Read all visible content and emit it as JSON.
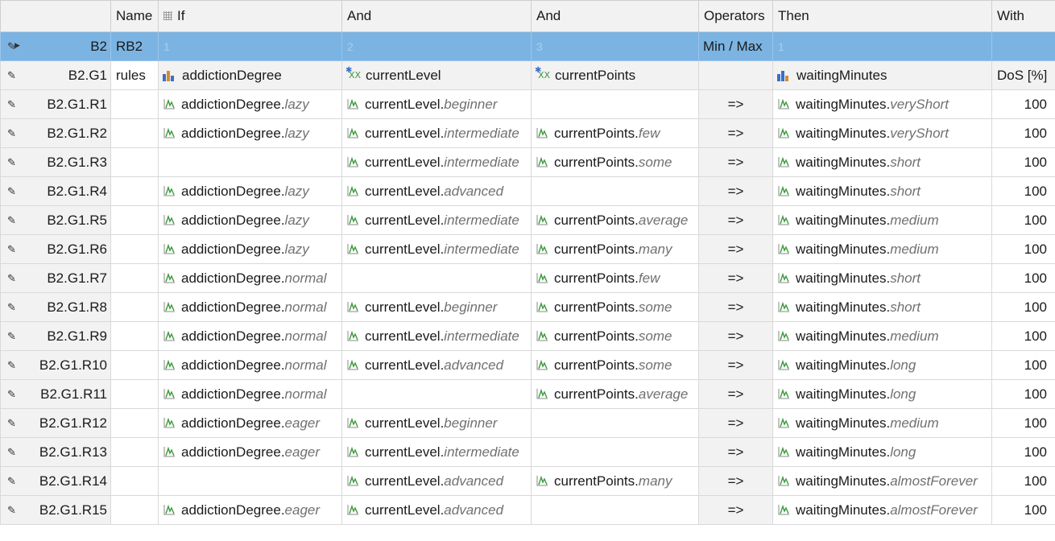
{
  "columns": {
    "rowhead": "",
    "name": "Name",
    "if": "If",
    "and1": "And",
    "and2": "And",
    "operators": "Operators",
    "then": "Then",
    "with": "With"
  },
  "rulebase": {
    "id": "B2",
    "name": "RB2",
    "if_num": "1",
    "and1_num": "2",
    "and2_num": "3",
    "operators": "Min / Max",
    "then_num": "1"
  },
  "group": {
    "id": "B2.G1",
    "name": "rules",
    "if_var": "addictionDegree",
    "and1_var": "currentLevel",
    "and2_var": "currentPoints",
    "then_var": "waitingMinutes",
    "with": "DoS [%]"
  },
  "colors": {
    "selected_row": "#7bb4e3",
    "header_bg": "#f2f2f2",
    "mf_icon": "#3b9a3b",
    "term_text": "#707070"
  },
  "rules": [
    {
      "id": "B2.G1.R1",
      "if_var": "addictionDegree",
      "if_term": "lazy",
      "and1_var": "currentLevel",
      "and1_term": "beginner",
      "and2_var": "",
      "and2_term": "",
      "op": "=>",
      "then_var": "waitingMinutes",
      "then_term": "veryShort",
      "dos": "100"
    },
    {
      "id": "B2.G1.R2",
      "if_var": "addictionDegree",
      "if_term": "lazy",
      "and1_var": "currentLevel",
      "and1_term": "intermediate",
      "and2_var": "currentPoints",
      "and2_term": "few",
      "op": "=>",
      "then_var": "waitingMinutes",
      "then_term": "veryShort",
      "dos": "100"
    },
    {
      "id": "B2.G1.R3",
      "if_var": "",
      "if_term": "",
      "and1_var": "currentLevel",
      "and1_term": "intermediate",
      "and2_var": "currentPoints",
      "and2_term": "some",
      "op": "=>",
      "then_var": "waitingMinutes",
      "then_term": "short",
      "dos": "100"
    },
    {
      "id": "B2.G1.R4",
      "if_var": "addictionDegree",
      "if_term": "lazy",
      "and1_var": "currentLevel",
      "and1_term": "advanced",
      "and2_var": "",
      "and2_term": "",
      "op": "=>",
      "then_var": "waitingMinutes",
      "then_term": "short",
      "dos": "100"
    },
    {
      "id": "B2.G1.R5",
      "if_var": "addictionDegree",
      "if_term": "lazy",
      "and1_var": "currentLevel",
      "and1_term": "intermediate",
      "and2_var": "currentPoints",
      "and2_term": "average",
      "op": "=>",
      "then_var": "waitingMinutes",
      "then_term": "medium",
      "dos": "100"
    },
    {
      "id": "B2.G1.R6",
      "if_var": "addictionDegree",
      "if_term": "lazy",
      "and1_var": "currentLevel",
      "and1_term": "intermediate",
      "and2_var": "currentPoints",
      "and2_term": "many",
      "op": "=>",
      "then_var": "waitingMinutes",
      "then_term": "medium",
      "dos": "100"
    },
    {
      "id": "B2.G1.R7",
      "if_var": "addictionDegree",
      "if_term": "normal",
      "and1_var": "",
      "and1_term": "",
      "and2_var": "currentPoints",
      "and2_term": "few",
      "op": "=>",
      "then_var": "waitingMinutes",
      "then_term": "short",
      "dos": "100"
    },
    {
      "id": "B2.G1.R8",
      "if_var": "addictionDegree",
      "if_term": "normal",
      "and1_var": "currentLevel",
      "and1_term": "beginner",
      "and2_var": "currentPoints",
      "and2_term": "some",
      "op": "=>",
      "then_var": "waitingMinutes",
      "then_term": "short",
      "dos": "100"
    },
    {
      "id": "B2.G1.R9",
      "if_var": "addictionDegree",
      "if_term": "normal",
      "and1_var": "currentLevel",
      "and1_term": "intermediate",
      "and2_var": "currentPoints",
      "and2_term": "some",
      "op": "=>",
      "then_var": "waitingMinutes",
      "then_term": "medium",
      "dos": "100"
    },
    {
      "id": "B2.G1.R10",
      "if_var": "addictionDegree",
      "if_term": "normal",
      "and1_var": "currentLevel",
      "and1_term": "advanced",
      "and2_var": "currentPoints",
      "and2_term": "some",
      "op": "=>",
      "then_var": "waitingMinutes",
      "then_term": "long",
      "dos": "100"
    },
    {
      "id": "B2.G1.R11",
      "if_var": "addictionDegree",
      "if_term": "normal",
      "and1_var": "",
      "and1_term": "",
      "and2_var": "currentPoints",
      "and2_term": "average",
      "op": "=>",
      "then_var": "waitingMinutes",
      "then_term": "long",
      "dos": "100"
    },
    {
      "id": "B2.G1.R12",
      "if_var": "addictionDegree",
      "if_term": "eager",
      "and1_var": "currentLevel",
      "and1_term": "beginner",
      "and2_var": "",
      "and2_term": "",
      "op": "=>",
      "then_var": "waitingMinutes",
      "then_term": "medium",
      "dos": "100"
    },
    {
      "id": "B2.G1.R13",
      "if_var": "addictionDegree",
      "if_term": "eager",
      "and1_var": "currentLevel",
      "and1_term": "intermediate",
      "and2_var": "",
      "and2_term": "",
      "op": "=>",
      "then_var": "waitingMinutes",
      "then_term": "long",
      "dos": "100"
    },
    {
      "id": "B2.G1.R14",
      "if_var": "",
      "if_term": "",
      "and1_var": "currentLevel",
      "and1_term": "advanced",
      "and2_var": "currentPoints",
      "and2_term": "many",
      "op": "=>",
      "then_var": "waitingMinutes",
      "then_term": "almostForever",
      "dos": "100"
    },
    {
      "id": "B2.G1.R15",
      "if_var": "addictionDegree",
      "if_term": "eager",
      "and1_var": "currentLevel",
      "and1_term": "advanced",
      "and2_var": "",
      "and2_term": "",
      "op": "=>",
      "then_var": "waitingMinutes",
      "then_term": "almostForever",
      "dos": "100"
    }
  ]
}
